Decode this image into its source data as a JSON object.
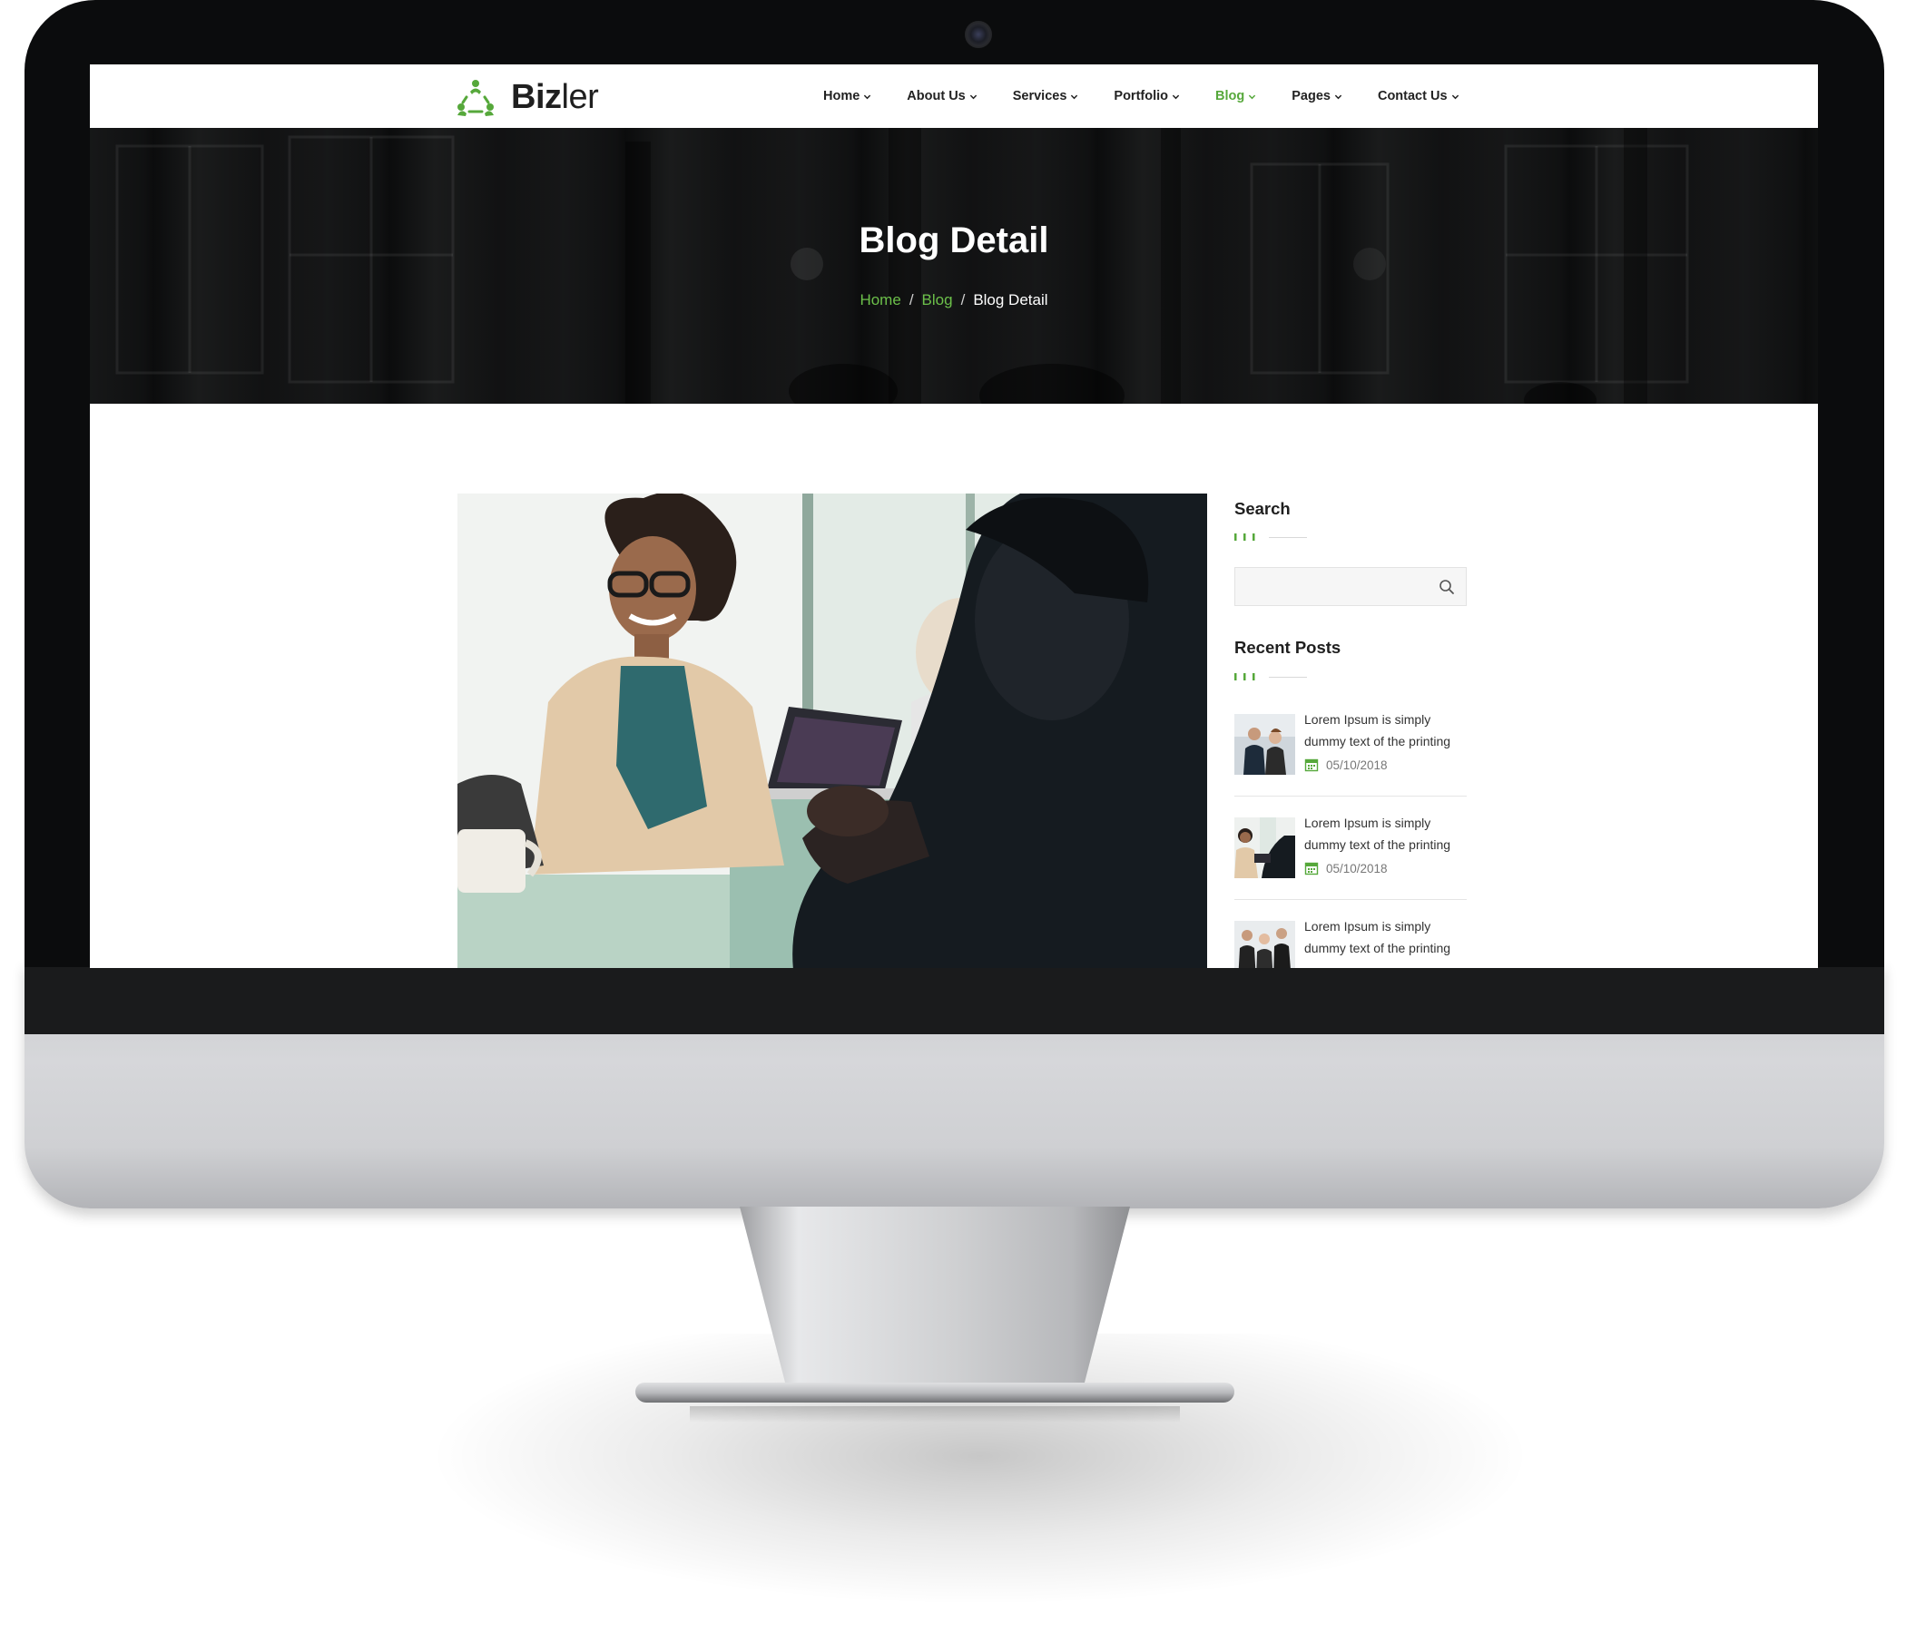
{
  "brand": {
    "name_bold": "Biz",
    "name_light": "ler",
    "accent": "#56a83b"
  },
  "nav": {
    "items": [
      {
        "label": "Home"
      },
      {
        "label": "About Us"
      },
      {
        "label": "Services"
      },
      {
        "label": "Portfolio"
      },
      {
        "label": "Blog",
        "active": true
      },
      {
        "label": "Pages"
      },
      {
        "label": "Contact Us"
      }
    ]
  },
  "hero": {
    "title": "Blog Detail",
    "breadcrumb": {
      "home": "Home",
      "blog": "Blog",
      "current": "Blog Detail",
      "separator": "/"
    }
  },
  "sidebar": {
    "search": {
      "title": "Search",
      "placeholder": ""
    },
    "recent": {
      "title": "Recent Posts",
      "posts": [
        {
          "title": "Lorem Ipsum is simply dummy text of the printing",
          "date": "05/10/2018"
        },
        {
          "title": "Lorem Ipsum is simply dummy text of the printing",
          "date": "05/10/2018"
        },
        {
          "title": "Lorem Ipsum is simply dummy text of the printing",
          "date": ""
        }
      ]
    }
  },
  "icons": {
    "logo": "people-cycle-logo-icon",
    "nav_caret": "chevron-down-icon",
    "search": "search-icon",
    "date": "calendar-icon"
  }
}
